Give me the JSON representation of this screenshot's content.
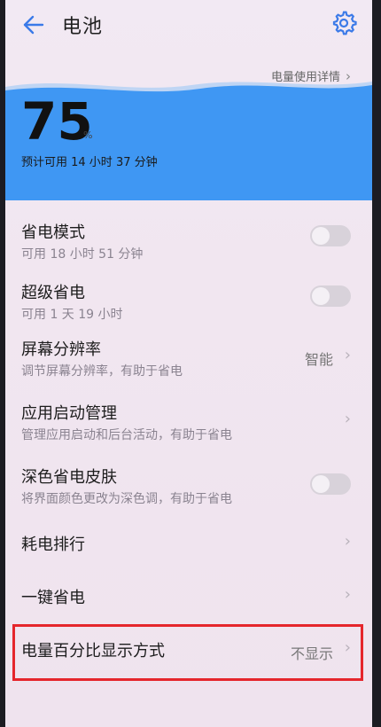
{
  "header": {
    "title": "电池"
  },
  "battery": {
    "percent": "75",
    "percent_sign": "%",
    "estimate": "预计可用 14 小时 37 分钟",
    "level": 0.75,
    "detail_link": "电量使用详情",
    "wave_color": "#3f97f3"
  },
  "settings": {
    "power_saving": {
      "title": "省电模式",
      "subtitle": "可用 18 小时 51 分钟",
      "toggle_on": false
    },
    "ultra_saving": {
      "title": "超级省电",
      "subtitle": "可用 1 天 19 小时",
      "toggle_on": false
    },
    "resolution": {
      "title": "屏幕分辨率",
      "subtitle": "调节屏幕分辨率，有助于省电",
      "value": "智能"
    },
    "app_launch": {
      "title": "应用启动管理",
      "subtitle": "管理应用启动和后台活动，有助于省电"
    },
    "dark_skin": {
      "title": "深色省电皮肤",
      "subtitle": "将界面颜色更改为深色调，有助于省电",
      "toggle_on": false
    },
    "power_ranking": {
      "title": "耗电排行"
    },
    "one_key": {
      "title": "一键省电"
    },
    "percent_display": {
      "title": "电量百分比显示方式",
      "value": "不显示"
    }
  },
  "colors": {
    "accent": "#3b7ae8",
    "highlight_border": "#e5262c"
  }
}
